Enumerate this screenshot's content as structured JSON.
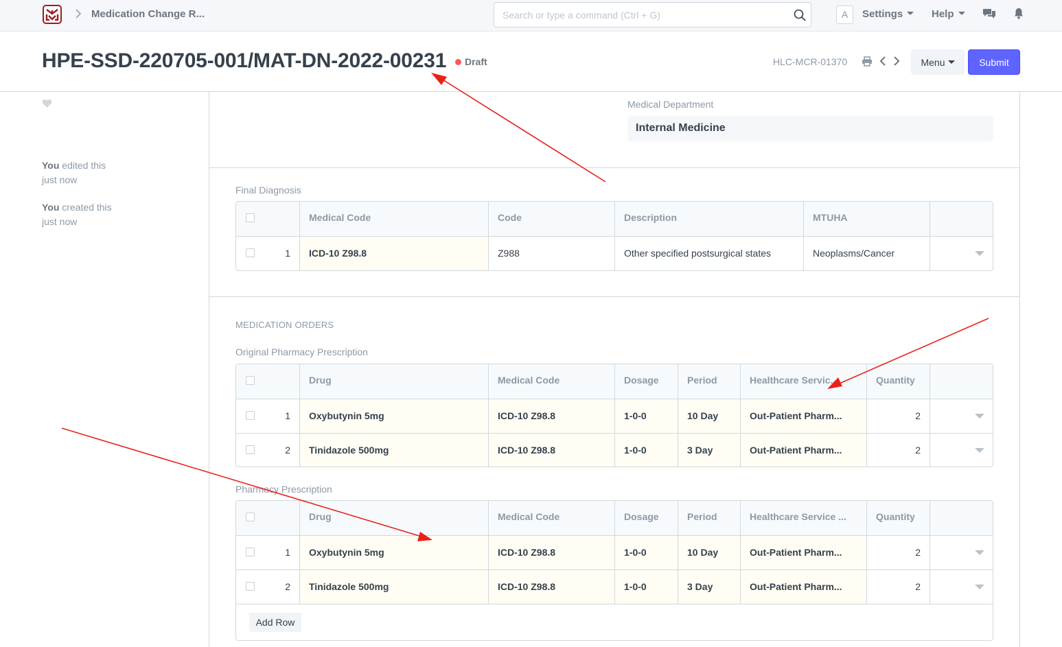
{
  "navbar": {
    "breadcrumb": "Medication Change R...",
    "search_placeholder": "Search or type a command (Ctrl + G)",
    "avatar_letter": "A",
    "settings_label": "Settings",
    "help_label": "Help"
  },
  "page": {
    "title": "HPE-SSD-220705-001/MAT-DN-2022-00231",
    "status": "Draft",
    "doc_ref": "HLC-MCR-01370",
    "menu_label": "Menu",
    "submit_label": "Submit"
  },
  "sidebar": {
    "timeline": [
      {
        "who": "You",
        "action": "edited this",
        "when": "just now"
      },
      {
        "who": "You",
        "action": "created this",
        "when": "just now"
      }
    ]
  },
  "form": {
    "medical_department_label": "Medical Department",
    "medical_department_value": "Internal Medicine",
    "final_diagnosis": {
      "label": "Final Diagnosis",
      "columns": [
        "Medical Code",
        "Code",
        "Description",
        "MTUHA"
      ],
      "rows": [
        {
          "idx": "1",
          "medical_code": "ICD-10 Z98.8",
          "code": "Z988",
          "description": "Other specified postsurgical states",
          "mtuha": "Neoplasms/Cancer"
        }
      ]
    },
    "medication_orders_title": "MEDICATION ORDERS",
    "original_prescription": {
      "label": "Original Pharmacy Prescription",
      "columns": [
        "Drug",
        "Medical Code",
        "Dosage",
        "Period",
        "Healthcare Servic...",
        "Quantity"
      ],
      "rows": [
        {
          "idx": "1",
          "drug": "Oxybutynin 5mg",
          "medical_code": "ICD-10 Z98.8",
          "dosage": "1-0-0",
          "period": "10 Day",
          "service": "Out-Patient Pharm...",
          "qty": "2"
        },
        {
          "idx": "2",
          "drug": "Tinidazole 500mg",
          "medical_code": "ICD-10 Z98.8",
          "dosage": "1-0-0",
          "period": "3 Day",
          "service": "Out-Patient Pharm...",
          "qty": "2"
        }
      ]
    },
    "pharmacy_prescription": {
      "label": "Pharmacy Prescription",
      "columns": [
        "Drug",
        "Medical Code",
        "Dosage",
        "Period",
        "Healthcare Service ...",
        "Quantity"
      ],
      "rows": [
        {
          "idx": "1",
          "drug": "Oxybutynin 5mg",
          "medical_code": "ICD-10 Z98.8",
          "dosage": "1-0-0",
          "period": "10 Day",
          "service": "Out-Patient Pharm...",
          "qty": "2"
        },
        {
          "idx": "2",
          "drug": "Tinidazole 500mg",
          "medical_code": "ICD-10 Z98.8",
          "dosage": "1-0-0",
          "period": "3 Day",
          "service": "Out-Patient Pharm...",
          "qty": "2"
        }
      ],
      "add_row_label": "Add Row"
    }
  },
  "colors": {
    "primary": "#5e64ff",
    "draft_indicator": "#ff5858",
    "annotation_arrow": "#e8221b",
    "mandatory_cell_bg": "#fffdf4"
  }
}
